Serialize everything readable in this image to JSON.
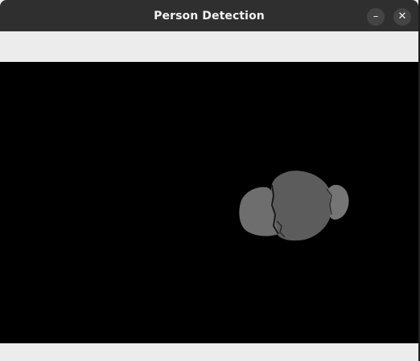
{
  "window": {
    "title": "Person Detection",
    "minimize_label": "–",
    "close_label": "✕"
  },
  "canvas": {
    "content": "depth-mask-person-blob",
    "colors": {
      "background": "#000000",
      "blob_main": "#5c5c5c",
      "blob_left": "#6e6e6e",
      "blob_right": "#757575"
    }
  }
}
